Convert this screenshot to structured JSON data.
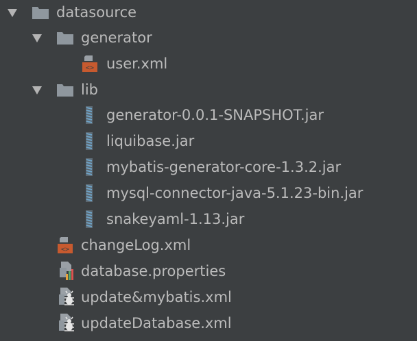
{
  "tree": {
    "items": [
      {
        "label": "datasource",
        "icon": "folder-icon",
        "expanded": true
      },
      {
        "label": "generator",
        "icon": "folder-icon",
        "expanded": true
      },
      {
        "label": "user.xml",
        "icon": "xml-file-icon"
      },
      {
        "label": "lib",
        "icon": "folder-icon",
        "expanded": true
      },
      {
        "label": "generator-0.0.1-SNAPSHOT.jar",
        "icon": "jar-icon"
      },
      {
        "label": "liquibase.jar",
        "icon": "jar-icon"
      },
      {
        "label": "mybatis-generator-core-1.3.2.jar",
        "icon": "jar-icon"
      },
      {
        "label": "mysql-connector-java-5.1.23-bin.jar",
        "icon": "jar-icon"
      },
      {
        "label": "snakeyaml-1.13.jar",
        "icon": "jar-icon"
      },
      {
        "label": "changeLog.xml",
        "icon": "xml-file-icon"
      },
      {
        "label": "database.properties",
        "icon": "properties-file-icon"
      },
      {
        "label": "update&mybatis.xml",
        "icon": "ant-build-icon"
      },
      {
        "label": "updateDatabase.xml",
        "icon": "ant-build-icon"
      }
    ]
  },
  "colors": {
    "background": "#3c3f41",
    "text": "#bbbbbb",
    "folder": "#8f979e",
    "xml_badge": "#c75a2f",
    "jar_stripe": "#6fa3c7"
  }
}
